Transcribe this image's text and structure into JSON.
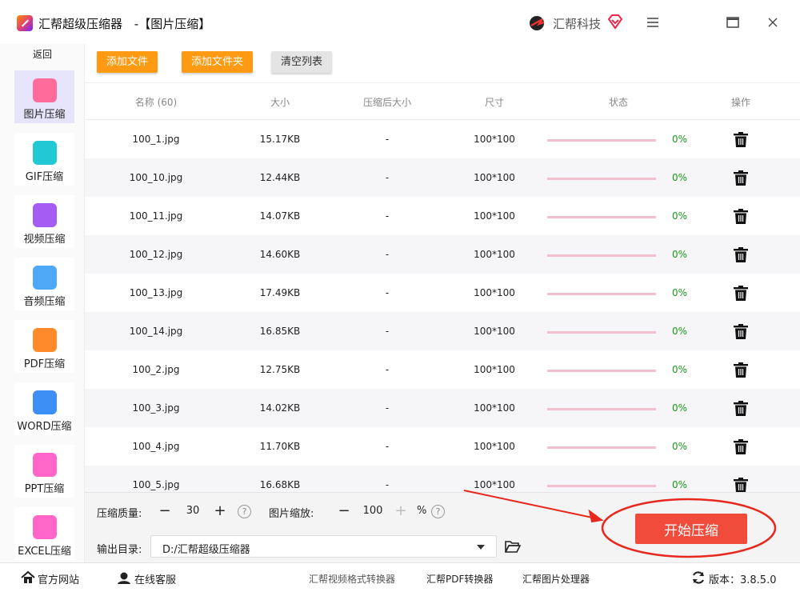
{
  "window": {
    "app_name": "汇帮超级压缩器",
    "subtitle": "-【图片压缩】",
    "brand": "汇帮科技"
  },
  "sidebar": {
    "back_label": "返回",
    "items": [
      {
        "label": "图片压缩",
        "icon": "image-icon",
        "color": "#ff6b9a",
        "active": true
      },
      {
        "label": "GIF压缩",
        "icon": "gif-icon",
        "color": "#22c8d4",
        "active": false
      },
      {
        "label": "视频压缩",
        "icon": "video-play-icon",
        "color": "#a45cf2",
        "active": false
      },
      {
        "label": "音频压缩",
        "icon": "audio-icon",
        "color": "#4fa8f5",
        "active": false
      },
      {
        "label": "PDF压缩",
        "icon": "pdf-file-icon",
        "color": "#ff8a2a",
        "active": false
      },
      {
        "label": "WORD压缩",
        "icon": "word-file-icon",
        "color": "#3d8ef5",
        "active": false
      },
      {
        "label": "PPT压缩",
        "icon": "ppt-file-icon",
        "color": "#ff66c8",
        "active": false
      },
      {
        "label": "EXCEL压缩",
        "icon": "excel-file-icon",
        "color": "#ff66c8",
        "active": false
      }
    ]
  },
  "toolbar": {
    "add_file": "添加文件",
    "add_folder": "添加文件夹",
    "clear_list": "清空列表"
  },
  "table": {
    "headers": {
      "name": "名称 (60)",
      "size": "大小",
      "compressed_size": "压缩后大小",
      "dimensions": "尺寸",
      "status": "状态",
      "actions": "操作"
    },
    "rows": [
      {
        "name": "100_1.jpg",
        "size": "15.17KB",
        "compressed": "-",
        "dims": "100*100",
        "progress": 0,
        "progress_text": "0%"
      },
      {
        "name": "100_10.jpg",
        "size": "12.44KB",
        "compressed": "-",
        "dims": "100*100",
        "progress": 0,
        "progress_text": "0%"
      },
      {
        "name": "100_11.jpg",
        "size": "14.07KB",
        "compressed": "-",
        "dims": "100*100",
        "progress": 0,
        "progress_text": "0%"
      },
      {
        "name": "100_12.jpg",
        "size": "14.60KB",
        "compressed": "-",
        "dims": "100*100",
        "progress": 0,
        "progress_text": "0%"
      },
      {
        "name": "100_13.jpg",
        "size": "17.49KB",
        "compressed": "-",
        "dims": "100*100",
        "progress": 0,
        "progress_text": "0%"
      },
      {
        "name": "100_14.jpg",
        "size": "16.85KB",
        "compressed": "-",
        "dims": "100*100",
        "progress": 0,
        "progress_text": "0%"
      },
      {
        "name": "100_2.jpg",
        "size": "12.75KB",
        "compressed": "-",
        "dims": "100*100",
        "progress": 0,
        "progress_text": "0%"
      },
      {
        "name": "100_3.jpg",
        "size": "14.02KB",
        "compressed": "-",
        "dims": "100*100",
        "progress": 0,
        "progress_text": "0%"
      },
      {
        "name": "100_4.jpg",
        "size": "11.70KB",
        "compressed": "-",
        "dims": "100*100",
        "progress": 0,
        "progress_text": "0%"
      },
      {
        "name": "100_5.jpg",
        "size": "16.68KB",
        "compressed": "-",
        "dims": "100*100",
        "progress": 0,
        "progress_text": "0%"
      }
    ]
  },
  "settings": {
    "quality_label": "压缩质量:",
    "quality_value": "30",
    "quality_minus": "−",
    "quality_plus": "+",
    "scale_label": "图片缩放:",
    "scale_value": "100",
    "scale_minus": "−",
    "scale_plus": "+",
    "scale_unit": "%",
    "help_glyph": "?",
    "output_label": "输出目录:",
    "output_value": "D:/汇帮超级压缩器",
    "start_button": "开始压缩"
  },
  "statusbar": {
    "website": "官方网站",
    "support": "在线客服",
    "link1": "汇帮视频格式转换器",
    "link2": "汇帮PDF转换器",
    "link3": "汇帮图片处理器",
    "version": "版本：3.8.5.0"
  },
  "colors": {
    "accent_orange": "#ff9a12",
    "start_red": "#f14b3c",
    "progress_green": "#1a9b1a",
    "annotation_red": "#e8281e"
  }
}
